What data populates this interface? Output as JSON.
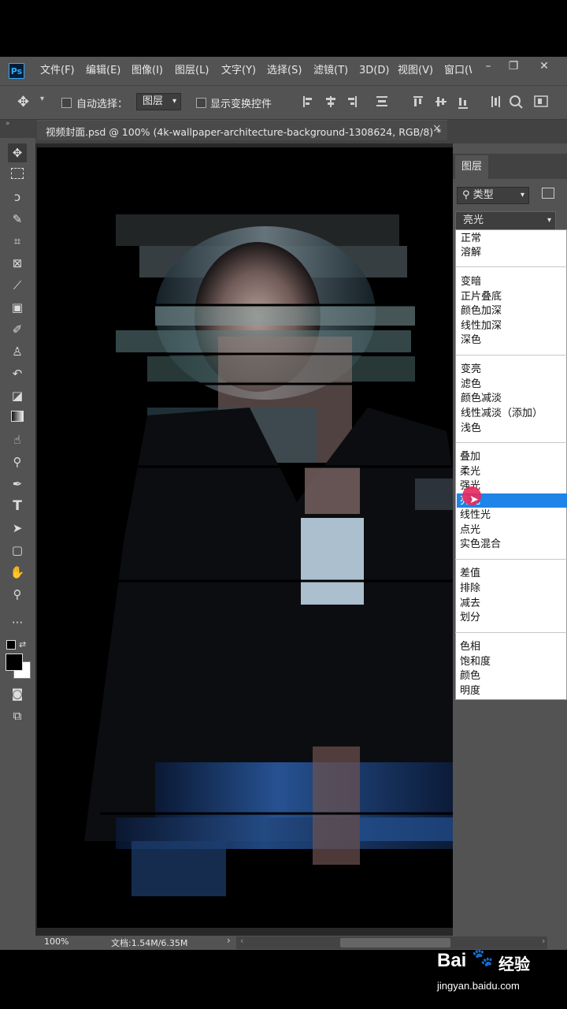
{
  "app": {
    "logo": "Ps"
  },
  "menu": [
    "文件(F)",
    "编辑(E)",
    "图像(I)",
    "图层(L)",
    "文字(Y)",
    "选择(S)",
    "滤镜(T)",
    "3D(D)",
    "视图(V)",
    "窗口(W"
  ],
  "options_bar": {
    "auto_select_label": "自动选择：",
    "auto_select_target": "图层",
    "show_transform_label": "显示变换控件"
  },
  "document_tab": {
    "title": "视频封面.psd @ 100% (4k-wallpaper-architecture-background-1308624, RGB/8) *",
    "close": "×"
  },
  "layers_panel": {
    "tab_label": "图层",
    "filter_kind": "类型",
    "blend_mode_current": "亮光"
  },
  "blend_menu": {
    "groups": [
      [
        "正常",
        "溶解"
      ],
      [
        "变暗",
        "正片叠底",
        "颜色加深",
        "线性加深",
        "深色"
      ],
      [
        "变亮",
        "滤色",
        "颜色减淡",
        "线性减淡（添加）",
        "浅色"
      ],
      [
        "叠加",
        "柔光",
        "强光",
        "亮光",
        "线性光",
        "点光",
        "实色混合"
      ],
      [
        "差值",
        "排除",
        "减去",
        "划分"
      ],
      [
        "色相",
        "饱和度",
        "颜色",
        "明度"
      ]
    ],
    "highlighted": "亮光"
  },
  "status_bar": {
    "zoom": "100%",
    "doc_size": "文档:1.54M/6.35M"
  },
  "watermark": {
    "brand": "Bai",
    "brand_suffix": "经验",
    "url": "jingyan.baidu.com"
  },
  "colors": {
    "ui_gray": "#535353",
    "highlight": "#1e84e8",
    "cursor": "#e8275d"
  },
  "icons": [
    "move-tool-icon",
    "marquee-tool-icon",
    "lasso-tool-icon",
    "quick-select-icon",
    "crop-icon",
    "frame-icon",
    "eyedropper-icon",
    "healing-brush-icon",
    "brush-icon",
    "clone-stamp-icon",
    "history-brush-icon",
    "eraser-icon",
    "gradient-icon",
    "smudge-icon",
    "dodge-icon",
    "pen-icon",
    "type-icon",
    "path-select-icon",
    "shape-icon",
    "hand-icon",
    "zoom-icon",
    "more-tools-icon"
  ]
}
